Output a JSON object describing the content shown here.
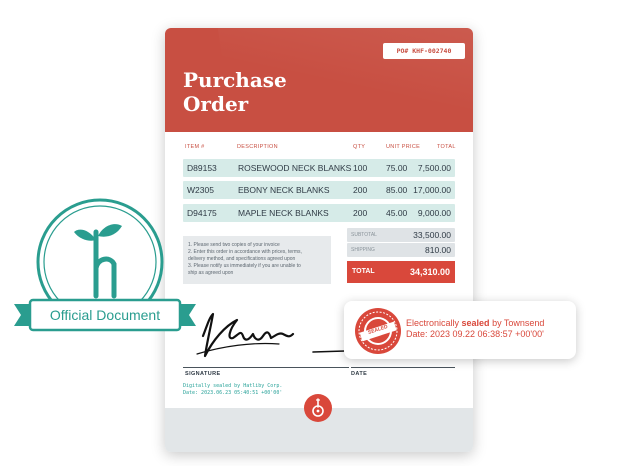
{
  "document": {
    "po_number": "PO# KHF-002740",
    "title": "Purchase\nOrder",
    "columns": [
      "ITEM #",
      "DESCRIPTION",
      "QTY",
      "UNIT PRICE",
      "TOTAL"
    ],
    "items": [
      {
        "item": "D89153",
        "description": "ROSEWOOD NECK BLANKS",
        "qty": "100",
        "unit_price": "75.00",
        "total": "7,500.00"
      },
      {
        "item": "W2305",
        "description": "EBONY NECK BLANKS",
        "qty": "200",
        "unit_price": "85.00",
        "total": "17,000.00"
      },
      {
        "item": "D94175",
        "description": "MAPLE NECK BLANKS",
        "qty": "200",
        "unit_price": "45.00",
        "total": "9,000.00"
      }
    ],
    "notes": [
      "1. Please send two copies of your invoice",
      "2. Enter this order in accordance with prices, terms,",
      "delivery method, and specifications agreed upon",
      "3. Please notify us immediately if you are unable to",
      "ship as agreed upon"
    ],
    "subtotal_label": "SUBTOTAL",
    "subtotal_value": "33,500.00",
    "shipping_label": "SHIPPING",
    "shipping_value": "810.00",
    "total_label": "TOTAL",
    "total_value": "34,310.00",
    "signature_label": "SIGNATURE",
    "date_label": "DATE",
    "digital_seal_line1": "Digitally sealed by Hatliby Corp.",
    "digital_seal_line2": "Date: 2023.06.23 05:40:51 +00'00'"
  },
  "badge": {
    "label": "Official Document",
    "color": "#2a9d8f"
  },
  "seal_card": {
    "stamp_text": "SEALED",
    "line1_prefix": "Electronically ",
    "line1_bold": "sealed",
    "line1_suffix": " by Townsend",
    "line2": "Date: 2023 09.22 06:38:57 +00'00'"
  },
  "colors": {
    "brand_red": "#c84f42",
    "row_teal": "#d6ebe8",
    "accent_red": "#d9483b"
  }
}
